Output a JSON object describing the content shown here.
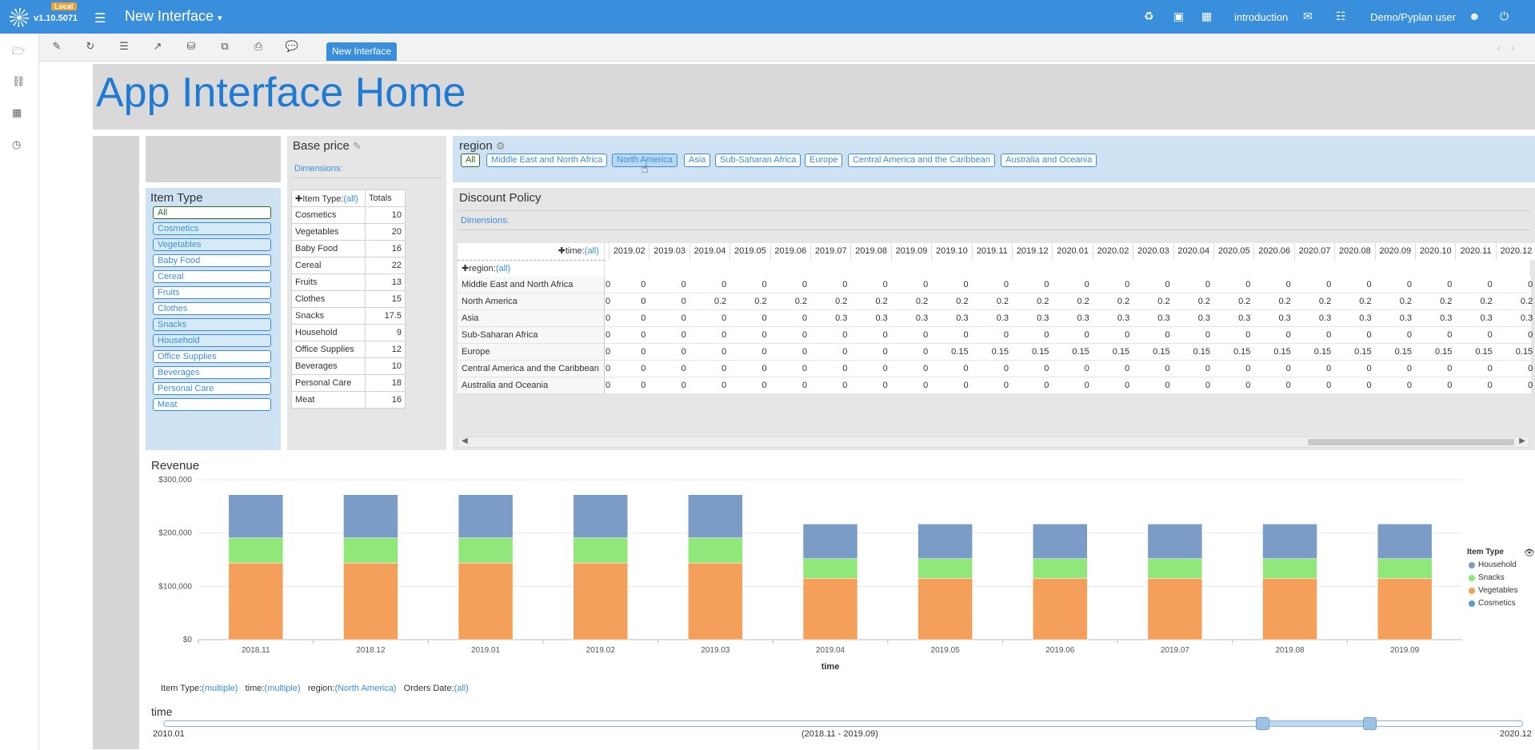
{
  "header": {
    "badge": "Local",
    "version": "v1.10.5071",
    "app_title": "New Interface",
    "menu_caret": "▾",
    "introduction": "introduction",
    "user": "Demo/Pyplan user"
  },
  "toolbar": {
    "active_tab": "New Interface"
  },
  "hero": {
    "title": "App Interface Home"
  },
  "item_type_selector": {
    "title": "Item Type",
    "items": [
      {
        "label": "All",
        "state": "all"
      },
      {
        "label": "Cosmetics",
        "state": "selected"
      },
      {
        "label": "Vegetables",
        "state": "selected"
      },
      {
        "label": "Baby Food",
        "state": "unselected"
      },
      {
        "label": "Cereal",
        "state": "unselected"
      },
      {
        "label": "Fruits",
        "state": "unselected"
      },
      {
        "label": "Clothes",
        "state": "unselected"
      },
      {
        "label": "Snacks",
        "state": "selected"
      },
      {
        "label": "Household",
        "state": "selected"
      },
      {
        "label": "Office Supplies",
        "state": "unselected"
      },
      {
        "label": "Beverages",
        "state": "unselected"
      },
      {
        "label": "Personal Care",
        "state": "unselected"
      },
      {
        "label": "Meat",
        "state": "unselected"
      }
    ]
  },
  "base_price": {
    "title": "Base price",
    "dimensions_label": "Dimensions:",
    "header_item": "Item Type:",
    "header_item_value": "(all)",
    "header_totals": "Totals",
    "rows": [
      {
        "name": "Cosmetics",
        "value": "10"
      },
      {
        "name": "Vegetables",
        "value": "20"
      },
      {
        "name": "Baby Food",
        "value": "16"
      },
      {
        "name": "Cereal",
        "value": "22"
      },
      {
        "name": "Fruits",
        "value": "13"
      },
      {
        "name": "Clothes",
        "value": "15"
      },
      {
        "name": "Snacks",
        "value": "17.5"
      },
      {
        "name": "Household",
        "value": "9"
      },
      {
        "name": "Office Supplies",
        "value": "12"
      },
      {
        "name": "Beverages",
        "value": "10"
      },
      {
        "name": "Personal Care",
        "value": "18"
      },
      {
        "name": "Meat",
        "value": "16"
      }
    ]
  },
  "region_selector": {
    "title": "region",
    "items": [
      {
        "label": "All",
        "state": "all"
      },
      {
        "label": "Middle East and North Africa",
        "state": "unselected"
      },
      {
        "label": "North America",
        "state": "selected"
      },
      {
        "label": "Asia",
        "state": "unselected"
      },
      {
        "label": "Sub-Saharan Africa",
        "state": "unselected"
      },
      {
        "label": "Europe",
        "state": "unselected"
      },
      {
        "label": "Central America and the Caribbean",
        "state": "unselected"
      },
      {
        "label": "Australia and Oceania",
        "state": "unselected"
      }
    ]
  },
  "discount_policy": {
    "title": "Discount Policy",
    "dimensions_label": "Dimensions:",
    "col_dim": "time:",
    "col_dim_value": "(all)",
    "row_dim": "region:",
    "row_dim_value": "(all)",
    "columns": [
      "2019.02",
      "2019.03",
      "2019.04",
      "2019.05",
      "2019.06",
      "2019.07",
      "2019.08",
      "2019.09",
      "2019.10",
      "2019.11",
      "2019.12",
      "2020.01",
      "2020.02",
      "2020.03",
      "2020.04",
      "2020.05",
      "2020.06",
      "2020.07",
      "2020.08",
      "2020.09",
      "2020.10",
      "2020.11",
      "2020.12"
    ],
    "rows": [
      {
        "name": "Middle East and North Africa",
        "values": [
          "0",
          "0",
          "0",
          "0",
          "0",
          "0",
          "0",
          "0",
          "0",
          "0",
          "0",
          "0",
          "0",
          "0",
          "0",
          "0",
          "0",
          "0",
          "0",
          "0",
          "0",
          "0",
          "0"
        ]
      },
      {
        "name": "North America",
        "values": [
          "0",
          "0",
          "0.2",
          "0.2",
          "0.2",
          "0.2",
          "0.2",
          "0.2",
          "0.2",
          "0.2",
          "0.2",
          "0.2",
          "0.2",
          "0.2",
          "0.2",
          "0.2",
          "0.2",
          "0.2",
          "0.2",
          "0.2",
          "0.2",
          "0.2",
          "0.2"
        ]
      },
      {
        "name": "Asia",
        "values": [
          "0",
          "0",
          "0",
          "0",
          "0",
          "0.3",
          "0.3",
          "0.3",
          "0.3",
          "0.3",
          "0.3",
          "0.3",
          "0.3",
          "0.3",
          "0.3",
          "0.3",
          "0.3",
          "0.3",
          "0.3",
          "0.3",
          "0.3",
          "0.3",
          "0.3"
        ]
      },
      {
        "name": "Sub-Saharan Africa",
        "values": [
          "0",
          "0",
          "0",
          "0",
          "0",
          "0",
          "0",
          "0",
          "0",
          "0",
          "0",
          "0",
          "0",
          "0",
          "0",
          "0",
          "0",
          "0",
          "0",
          "0",
          "0",
          "0",
          "0"
        ]
      },
      {
        "name": "Europe",
        "values": [
          "0",
          "0",
          "0",
          "0",
          "0",
          "0",
          "0",
          "0",
          "0.15",
          "0.15",
          "0.15",
          "0.15",
          "0.15",
          "0.15",
          "0.15",
          "0.15",
          "0.15",
          "0.15",
          "0.15",
          "0.15",
          "0.15",
          "0.15",
          "0.15"
        ]
      },
      {
        "name": "Central America and the Caribbean",
        "values": [
          "0",
          "0",
          "0",
          "0",
          "0",
          "0",
          "0",
          "0",
          "0",
          "0",
          "0",
          "0",
          "0",
          "0",
          "0",
          "0",
          "0",
          "0",
          "0",
          "0",
          "0",
          "0",
          "0"
        ]
      },
      {
        "name": "Australia and Oceania",
        "values": [
          "0",
          "0",
          "0",
          "0",
          "0",
          "0",
          "0",
          "0",
          "0",
          "0",
          "0",
          "0",
          "0",
          "0",
          "0",
          "0",
          "0",
          "0",
          "0",
          "0",
          "0",
          "0",
          "0"
        ]
      }
    ]
  },
  "chart_data": {
    "type": "bar",
    "stacked": true,
    "title": "Revenue",
    "xlabel": "time",
    "ylabel": "",
    "ylim": [
      0,
      300000
    ],
    "yticks": [
      "$0",
      "$100,000",
      "$200,000",
      "$300,000"
    ],
    "categories": [
      "2018.11",
      "2018.12",
      "2019.01",
      "2019.02",
      "2019.03",
      "2019.04",
      "2019.05",
      "2019.06",
      "2019.07",
      "2019.08",
      "2019.09"
    ],
    "series": [
      {
        "name": "Cosmetics",
        "color": "#5a9bd5",
        "values": [
          0,
          0,
          0,
          0,
          0,
          0,
          0,
          0,
          0,
          0,
          0
        ]
      },
      {
        "name": "Vegetables",
        "color": "#f5a05a",
        "values": [
          144000,
          144000,
          144000,
          144000,
          144000,
          115000,
          115000,
          115000,
          115000,
          115000,
          115000
        ]
      },
      {
        "name": "Snacks",
        "color": "#90e87a",
        "values": [
          47000,
          47000,
          47000,
          47000,
          47000,
          37000,
          37000,
          37000,
          37000,
          37000,
          37000
        ]
      },
      {
        "name": "Household",
        "color": "#7a9cc6",
        "values": [
          81000,
          81000,
          81000,
          81000,
          81000,
          65000,
          65000,
          65000,
          65000,
          65000,
          65000
        ]
      }
    ],
    "legend_title": "Item Type",
    "legend_order": [
      "Household",
      "Snacks",
      "Vegetables",
      "Cosmetics"
    ],
    "legend_position": "right"
  },
  "filters": {
    "item_type_label": "Item Type:",
    "item_type_value": "(multiple)",
    "time_label": "time:",
    "time_value": "(multiple)",
    "region_label": "region:",
    "region_value": "(North America)",
    "orders_date_label": "Orders Date:",
    "orders_date_value": "(all)"
  },
  "time_slider": {
    "title": "time",
    "min": "2010.01",
    "max": "2020.12",
    "range_label": "(2018.11 - 2019.09)"
  }
}
